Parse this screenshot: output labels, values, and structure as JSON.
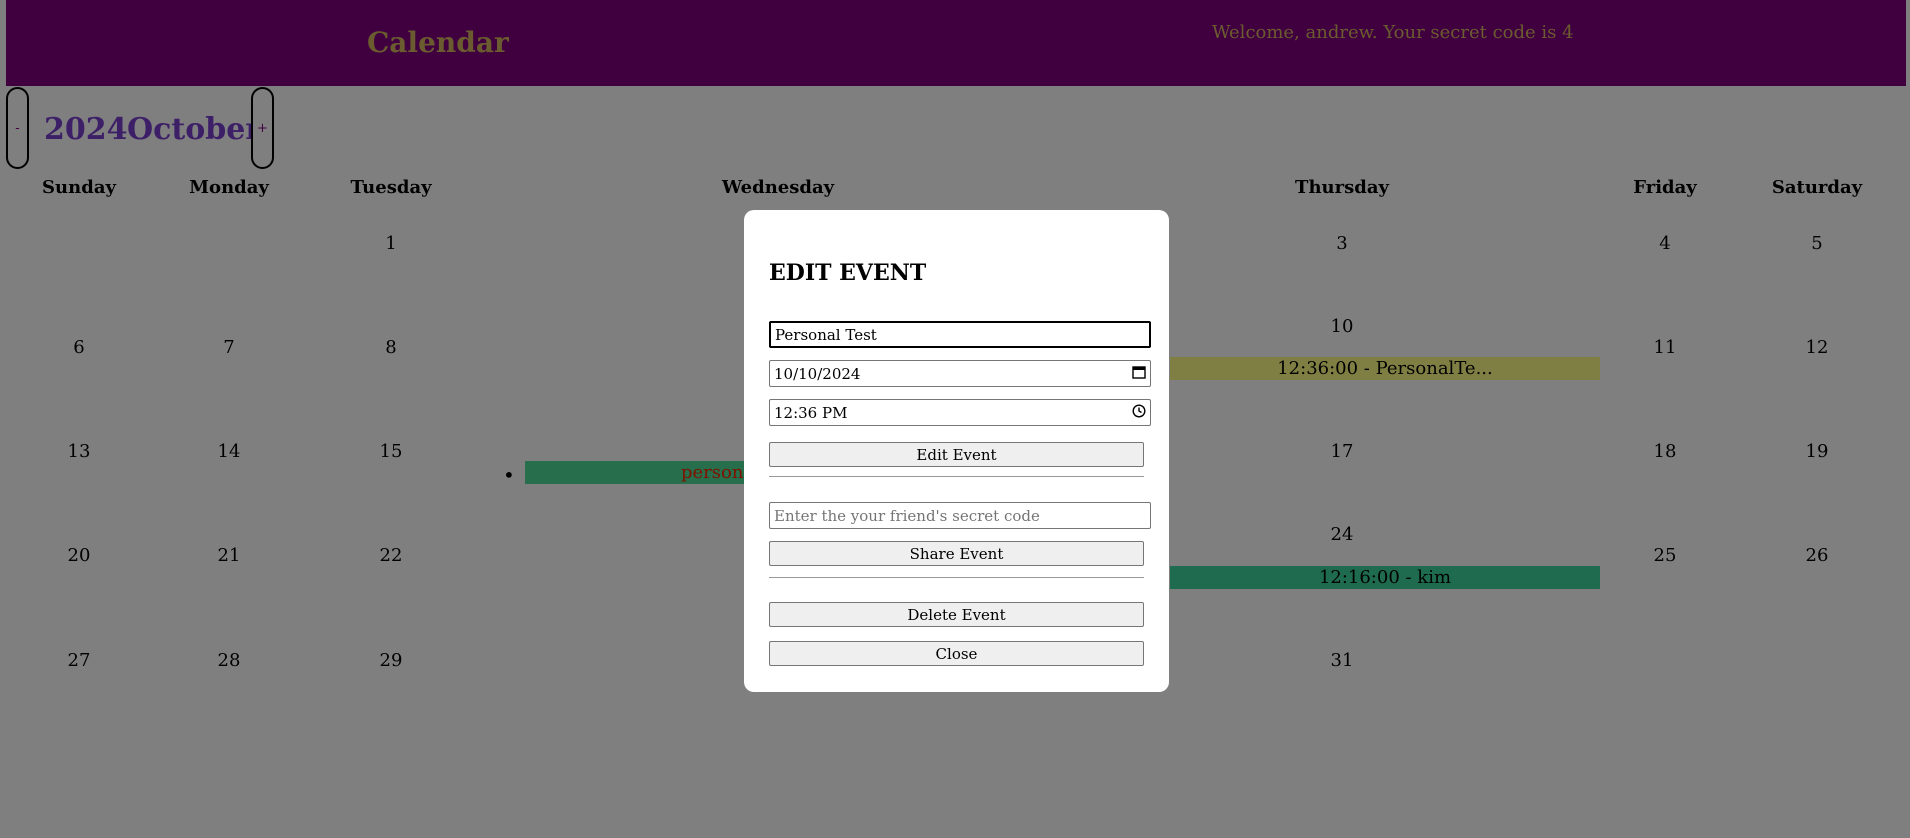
{
  "header": {
    "title": "Calendar",
    "welcome": "Welcome, andrew. Your secret code is 4"
  },
  "nav": {
    "prev_label": "-",
    "next_label": "+",
    "year": "2024",
    "month": "October"
  },
  "weekdays": [
    "Sunday",
    "Monday",
    "Tuesday",
    "Wednesday",
    "Thursday",
    "Friday",
    "Saturday"
  ],
  "days": {
    "d1": "1",
    "d3": "3",
    "d4": "4",
    "d5": "5",
    "d6": "6",
    "d7": "7",
    "d8": "8",
    "d10": "10",
    "d11": "11",
    "d12": "12",
    "d13": "13",
    "d14": "14",
    "d15": "15",
    "d17": "17",
    "d18": "18",
    "d19": "19",
    "d20": "20",
    "d21": "21",
    "d22": "22",
    "d24": "24",
    "d25": "25",
    "d26": "26",
    "d27": "27",
    "d28": "28",
    "d29": "29",
    "d31": "31"
  },
  "events": {
    "oct10": "12:36:00 - PersonalTe...",
    "oct16": "persona",
    "oct24": "12:16:00 - kim"
  },
  "colors": {
    "header_bg": "#800080",
    "header_text": "#D7B85E",
    "month_text": "#7A3FD0",
    "event_yellow": "#FFFF88",
    "event_green": "#4FDD98"
  },
  "modal": {
    "title": "EDIT EVENT",
    "name_value": "Personal Test",
    "date_value": "10/10/2024",
    "time_value": "12:36 PM",
    "edit_button": "Edit Event",
    "share_placeholder": "Enter the your friend's secret code",
    "share_button": "Share Event",
    "delete_button": "Delete Event",
    "close_button": "Close"
  },
  "icons": {
    "calendar_icon": "calendar-icon",
    "clock_icon": "clock-icon"
  }
}
